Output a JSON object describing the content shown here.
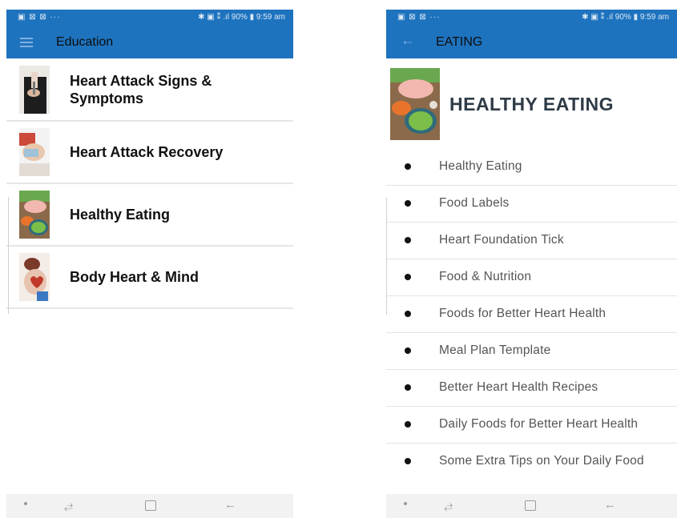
{
  "left_screen": {
    "status_bar": {
      "left_icons": "▣ ⊠ ⊠ ···",
      "right_text": "✱ ▣ ⁑ .ıl 90% ▮ 9:59 am"
    },
    "app_bar": {
      "title": "Education",
      "icon": "menu-icon"
    },
    "items": [
      {
        "label": "Heart Attack Signs & Symptoms",
        "icon": "chest-pain-thumbnail"
      },
      {
        "label": "Heart Attack Recovery",
        "icon": "medication-thumbnail"
      },
      {
        "label": "Healthy Eating",
        "icon": "healthy-food-thumbnail"
      },
      {
        "label": "Body Heart & Mind",
        "icon": "hands-heart-thumbnail"
      }
    ]
  },
  "right_screen": {
    "status_bar": {
      "left_icons": "▣ ⊠ ⊠ ···",
      "right_text": "✱ ▣ ⁑ .ıl 90% ▮ 9:59 am"
    },
    "app_bar": {
      "title": "EATING",
      "icon": "back-arrow-icon"
    },
    "header_title": "HEALTHY EATING",
    "items": [
      "Healthy Eating",
      "Food Labels",
      "Heart Foundation Tick",
      "Food & Nutrition",
      "Foods for Better Heart Health",
      "Meal Plan Template",
      "Better Heart Health Recipes",
      "Daily Foods for Better Heart Health",
      "Some Extra Tips on Your Daily Food"
    ]
  },
  "nav_bar": {
    "recents_glyph": "⥄",
    "back_glyph": "←"
  },
  "colors": {
    "app_bar": "#1e73be",
    "background": "#ffffff",
    "nav_bar": "#f2f2f2"
  }
}
